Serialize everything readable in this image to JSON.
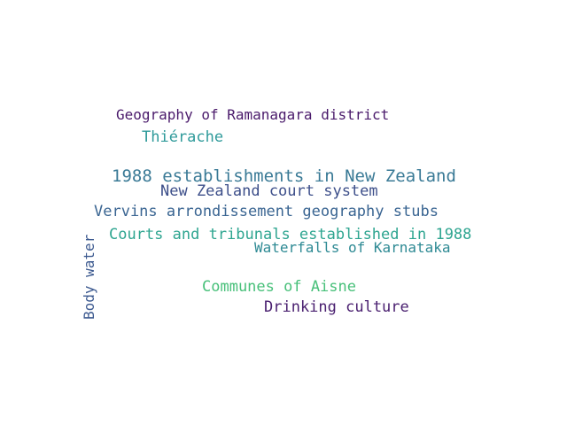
{
  "wordcloud": {
    "words": [
      {
        "text": "Geography of Ramanagara district",
        "color": "#4a1a6b"
      },
      {
        "text": "Thiérache",
        "color": "#2e9a9a"
      },
      {
        "text": "1988 establishments in New Zealand",
        "color": "#3a7a96"
      },
      {
        "text": "New Zealand court system",
        "color": "#3d4f8a"
      },
      {
        "text": "Vervins arrondissement geography stubs",
        "color": "#3a6592"
      },
      {
        "text": "Courts and tribunals established in 1988",
        "color": "#2ea590"
      },
      {
        "text": "Waterfalls of Karnataka",
        "color": "#2e8a94"
      },
      {
        "text": "Communes of Aisne",
        "color": "#48c07a"
      },
      {
        "text": "Drinking culture",
        "color": "#4a2070"
      },
      {
        "text": "Body water",
        "color": "#3d5a90"
      }
    ]
  }
}
